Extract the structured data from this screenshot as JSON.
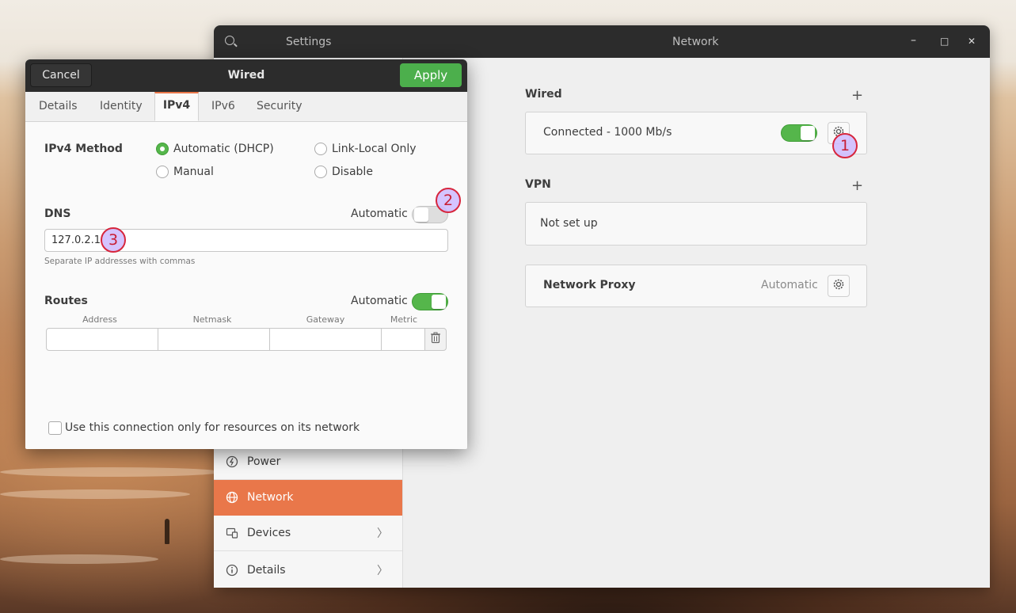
{
  "window": {
    "app_title": "Settings",
    "panel_title": "Network",
    "minimize_glyph": "–",
    "maximize_glyph": "□",
    "close_glyph": "✕"
  },
  "sidebar": {
    "items": [
      {
        "label": "Power",
        "icon": "power-icon"
      },
      {
        "label": "Network",
        "icon": "globe-icon",
        "active": true
      },
      {
        "label": "Devices",
        "icon": "devices-icon",
        "chevron": "〉"
      },
      {
        "label": "Details",
        "icon": "info-icon",
        "chevron": "〉"
      }
    ]
  },
  "network": {
    "wired_title": "Wired",
    "wired_status": "Connected - 1000 Mb/s",
    "wired_enabled": true,
    "vpn_title": "VPN",
    "vpn_status": "Not set up",
    "proxy_label": "Network Proxy",
    "proxy_value": "Automatic",
    "add_glyph": "+"
  },
  "dialog": {
    "title": "Wired",
    "cancel_label": "Cancel",
    "apply_label": "Apply",
    "tabs": [
      "Details",
      "Identity",
      "IPv4",
      "IPv6",
      "Security"
    ],
    "active_tab": "IPv4",
    "ipv4_method_label": "IPv4 Method",
    "methods": [
      {
        "label": "Automatic (DHCP)",
        "checked": true
      },
      {
        "label": "Link-Local Only",
        "checked": false
      },
      {
        "label": "Manual",
        "checked": false
      },
      {
        "label": "Disable",
        "checked": false
      }
    ],
    "dns_label": "DNS",
    "dns_automatic_label": "Automatic",
    "dns_automatic": false,
    "dns_value": "127.0.2.1",
    "dns_hint": "Separate IP addresses with commas",
    "routes_label": "Routes",
    "routes_automatic_label": "Automatic",
    "routes_automatic": true,
    "route_columns": [
      "Address",
      "Netmask",
      "Gateway",
      "Metric"
    ],
    "only_resources_label": "Use this connection only for resources on its network",
    "only_resources_checked": false
  },
  "callouts": [
    "1",
    "2",
    "3"
  ],
  "colors": {
    "accent": "#e9774a",
    "switch_on": "#55b64b",
    "apply_button": "#4caf4c",
    "callout_ring": "#d7263d",
    "callout_fill": "#cebaff"
  }
}
